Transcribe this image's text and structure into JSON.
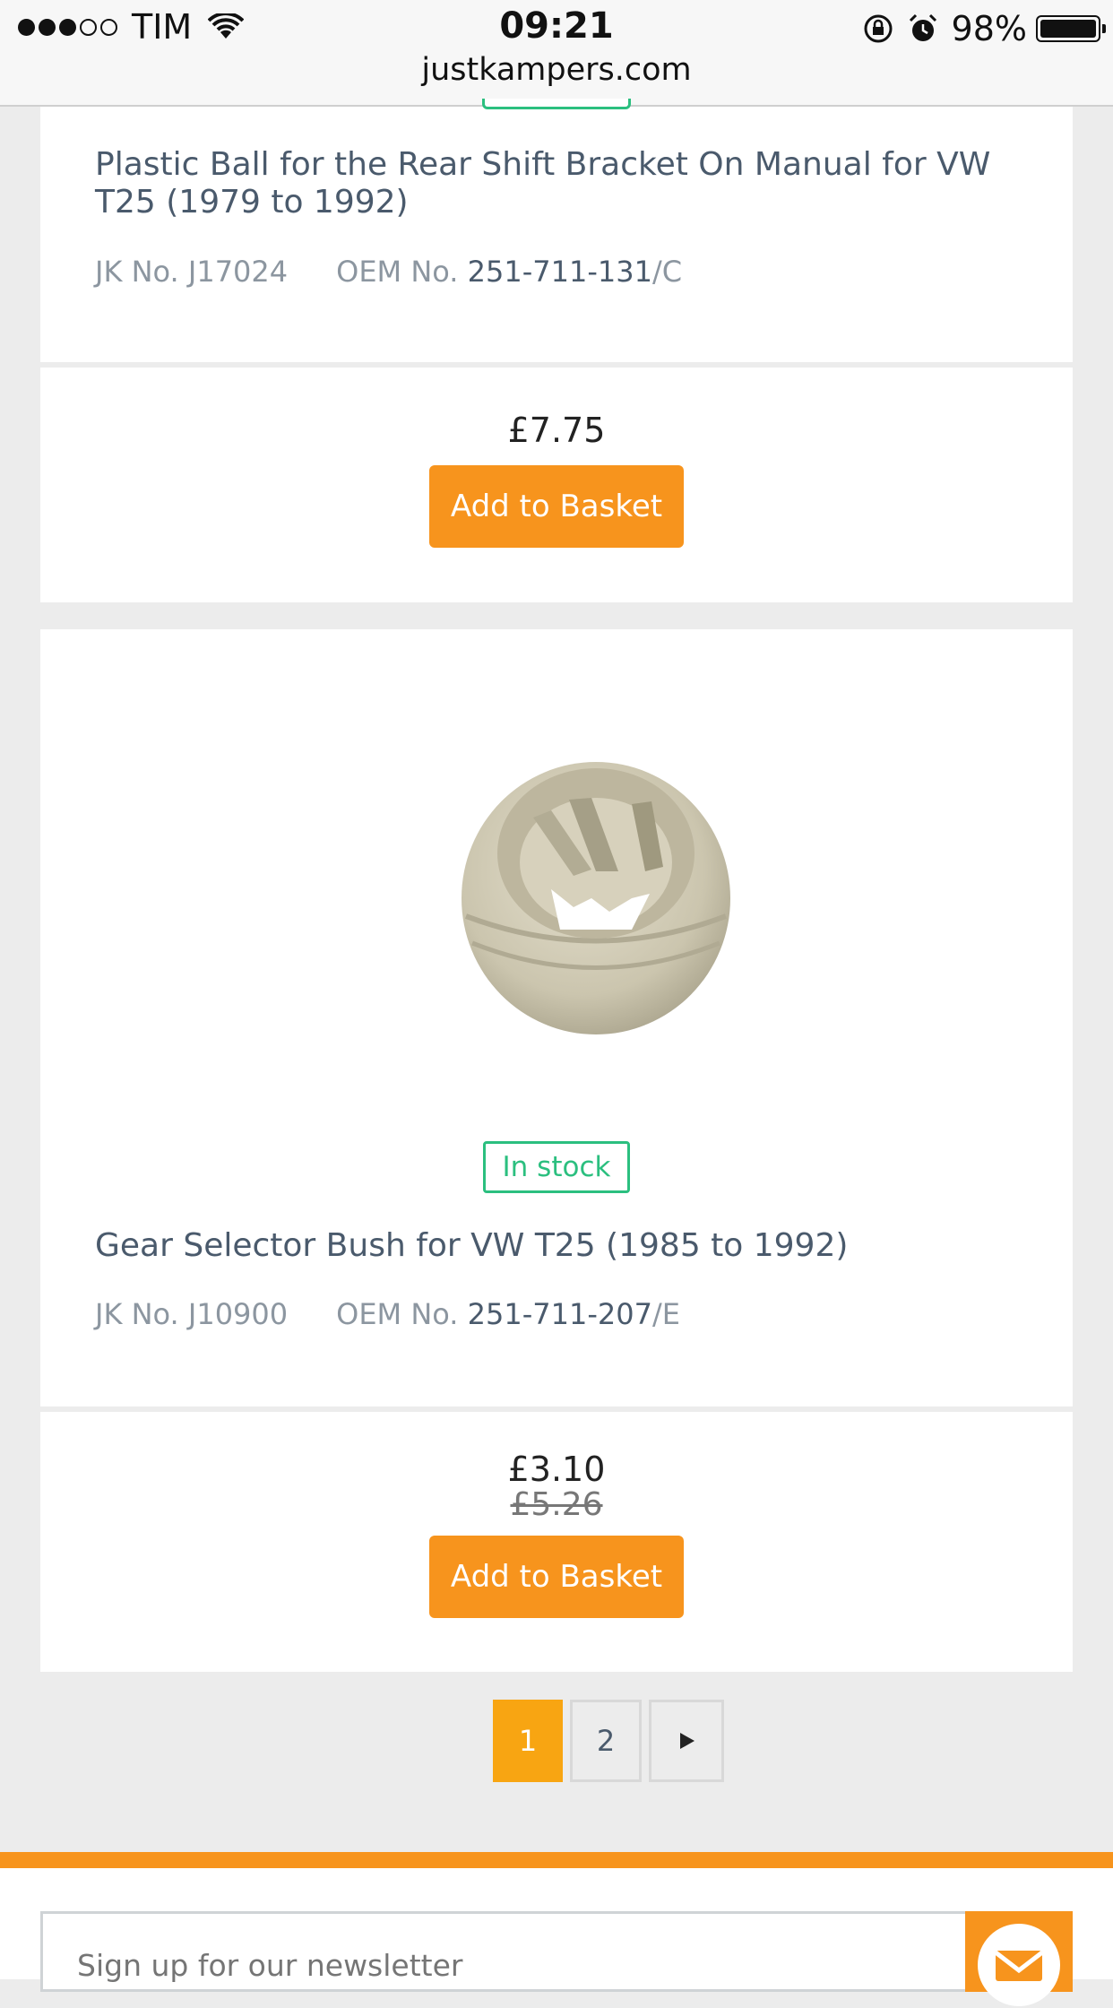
{
  "status_bar": {
    "carrier": "TIM",
    "time": "09:21",
    "battery": "98%"
  },
  "browser": {
    "url": "justkampers.com"
  },
  "products": [
    {
      "title": "Plastic Ball for the Rear Shift Bracket On Manual for VW T25 (1979 to 1992)",
      "jk_label": "JK No.",
      "jk_number": "J17024",
      "oem_label": "OEM No.",
      "oem_main": "251-711-131",
      "oem_suffix": "/C",
      "price": "£7.75",
      "button": "Add to Basket"
    },
    {
      "stock": "In stock",
      "title": "Gear Selector Bush for VW T25 (1985 to 1992)",
      "jk_label": "JK No.",
      "jk_number": "J10900",
      "oem_label": "OEM No.",
      "oem_main": "251-711-207",
      "oem_suffix": "/E",
      "price": "£3.10",
      "old_price": "£5.26",
      "button": "Add to Basket"
    }
  ],
  "pagination": {
    "pages": [
      "1",
      "2"
    ],
    "active": "1",
    "next_icon": "play-arrow"
  },
  "footer": {
    "newsletter_placeholder": "Sign up for our newsletter",
    "icon": "envelope-icon"
  },
  "colors": {
    "accent": "#f7941d",
    "stock_green": "#2bbf7f",
    "page_active": "#f8a512"
  }
}
